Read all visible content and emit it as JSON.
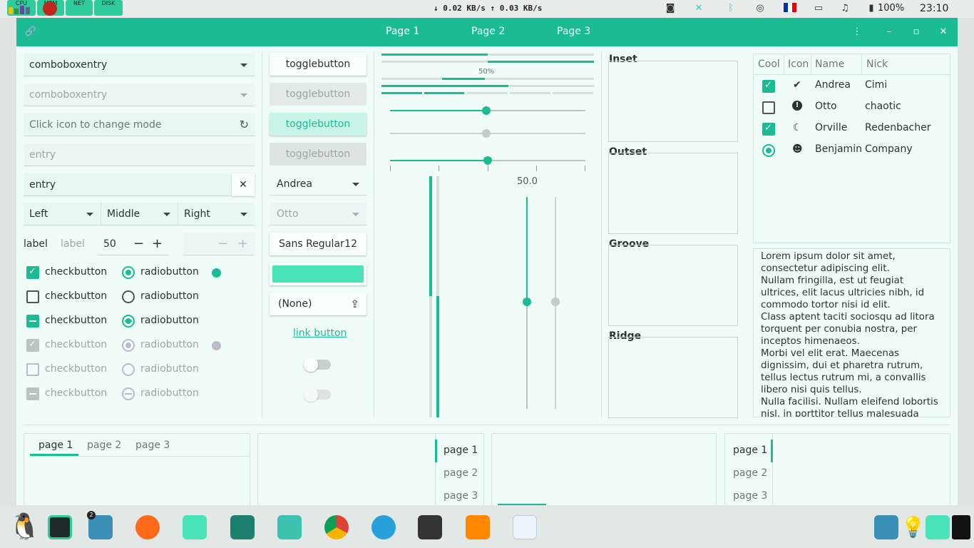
{
  "topbar": {
    "monitors": [
      "CPU",
      "MEM",
      "NET",
      "DISK"
    ],
    "netspeed": "↓ 0.02 KB/s ↑ 0.03 KB/s",
    "battery": "100%",
    "clock": "23:10"
  },
  "header": {
    "tabs": [
      "Page 1",
      "Page 2",
      "Page 3"
    ]
  },
  "col1": {
    "combo1": "comboboxentry",
    "combo2": "comboboxentry",
    "mode_placeholder": "Click icon to change mode",
    "entry_disabled": "entry",
    "entry": "entry",
    "seg": [
      "Left",
      "Middle",
      "Right"
    ],
    "label1": "label",
    "label2": "label",
    "spin_value": "50",
    "check": "checkbutton",
    "radio": "radiobutton"
  },
  "col2": {
    "toggle": "togglebutton",
    "combo_andrea": "Andrea",
    "combo_otto": "Otto",
    "font_name": "Sans Regular",
    "font_size": "12",
    "file_none": "(None)",
    "link": "link button",
    "color_swatch": "#4be3ba"
  },
  "col3": {
    "progress_label": "50%",
    "scale_value": "50.0"
  },
  "frames": [
    "Inset",
    "Outset",
    "Groove",
    "Ridge"
  ],
  "tree": {
    "headers": [
      "Cool",
      "Icon",
      "Name",
      "Nick"
    ],
    "rows": [
      {
        "name": "Andrea",
        "nick": "Cimi"
      },
      {
        "name": "Otto",
        "nick": "chaotic"
      },
      {
        "name": "Orville",
        "nick": "Redenbacher"
      },
      {
        "name": "Benjamin",
        "nick": "Company"
      }
    ]
  },
  "text": {
    "l1": "Lorem ipsum dolor sit amet,",
    "l2": "consectetur adipiscing elit.",
    "l3": "Nullam fringilla, est ut feugiat",
    "l4": "ultrices, elit lacus ultricies nibh, id",
    "l5": "commodo tortor nisi id elit.",
    "l6": "Class aptent taciti sociosqu ad litora",
    "l7": "torquent per conubia nostra, per",
    "l8": "inceptos himenaeos.",
    "l9": "Morbi vel elit erat. Maecenas",
    "l10": "dignissim, dui et pharetra rutrum,",
    "l11": "tellus lectus rutrum mi, a convallis",
    "l12": "libero nisi quis tellus.",
    "l13": "Nulla facilisi. Nullam eleifend lobortis",
    "l14": "nisl, in porttitor tellus malesuada"
  },
  "notebooks": {
    "pages": [
      "page 1",
      "page 2",
      "page 3"
    ]
  },
  "accent": "#1bbc94",
  "dock": {
    "badge": "2"
  }
}
